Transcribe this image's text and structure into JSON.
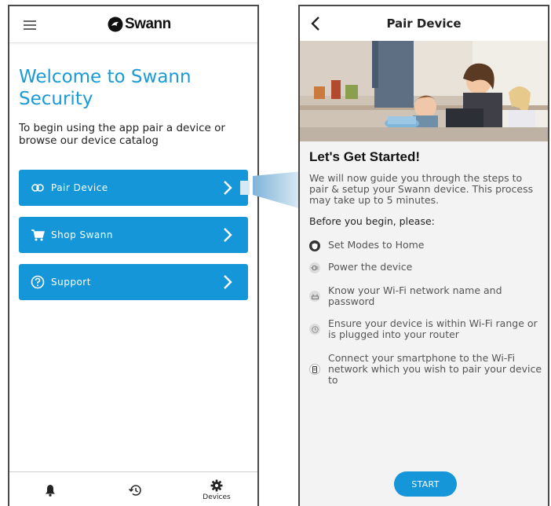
{
  "left_screen": {
    "brand": "Swann",
    "welcome_title": "Welcome to Swann Security",
    "intro_text": "To begin using the app pair a device or browse our device catalog",
    "menu": [
      {
        "label": "Pair Device",
        "icon": "link-icon"
      },
      {
        "label": "Shop Swann",
        "icon": "cart-icon"
      },
      {
        "label": "Support",
        "icon": "help-icon"
      }
    ],
    "bottom_nav": {
      "bell_icon": "bell-icon",
      "history_icon": "history-icon",
      "devices_label": "Devices"
    }
  },
  "right_screen": {
    "title": "Pair Device",
    "heading": "Let's Get Started!",
    "description": "We will now guide you through the steps to pair & setup your Swann device. This process may take up to 5 minutes.",
    "before_label": "Before you begin, please:",
    "steps": [
      {
        "text": "Set Modes to Home",
        "icon": "shield-icon"
      },
      {
        "text": "Power the device",
        "icon": "plug-icon"
      },
      {
        "text": "Know your Wi-Fi network name and password",
        "icon": "router-icon"
      },
      {
        "text": "Ensure your device is within Wi-Fi range or is plugged into your router",
        "icon": "clock-icon"
      },
      {
        "text": "Connect your smartphone to the Wi-Fi network which you wish to pair your device to",
        "icon": "phone-icon"
      }
    ],
    "start_label": "START"
  },
  "colors": {
    "accent_blue": "#1596d8",
    "welcome_blue": "#1a9ad7"
  }
}
